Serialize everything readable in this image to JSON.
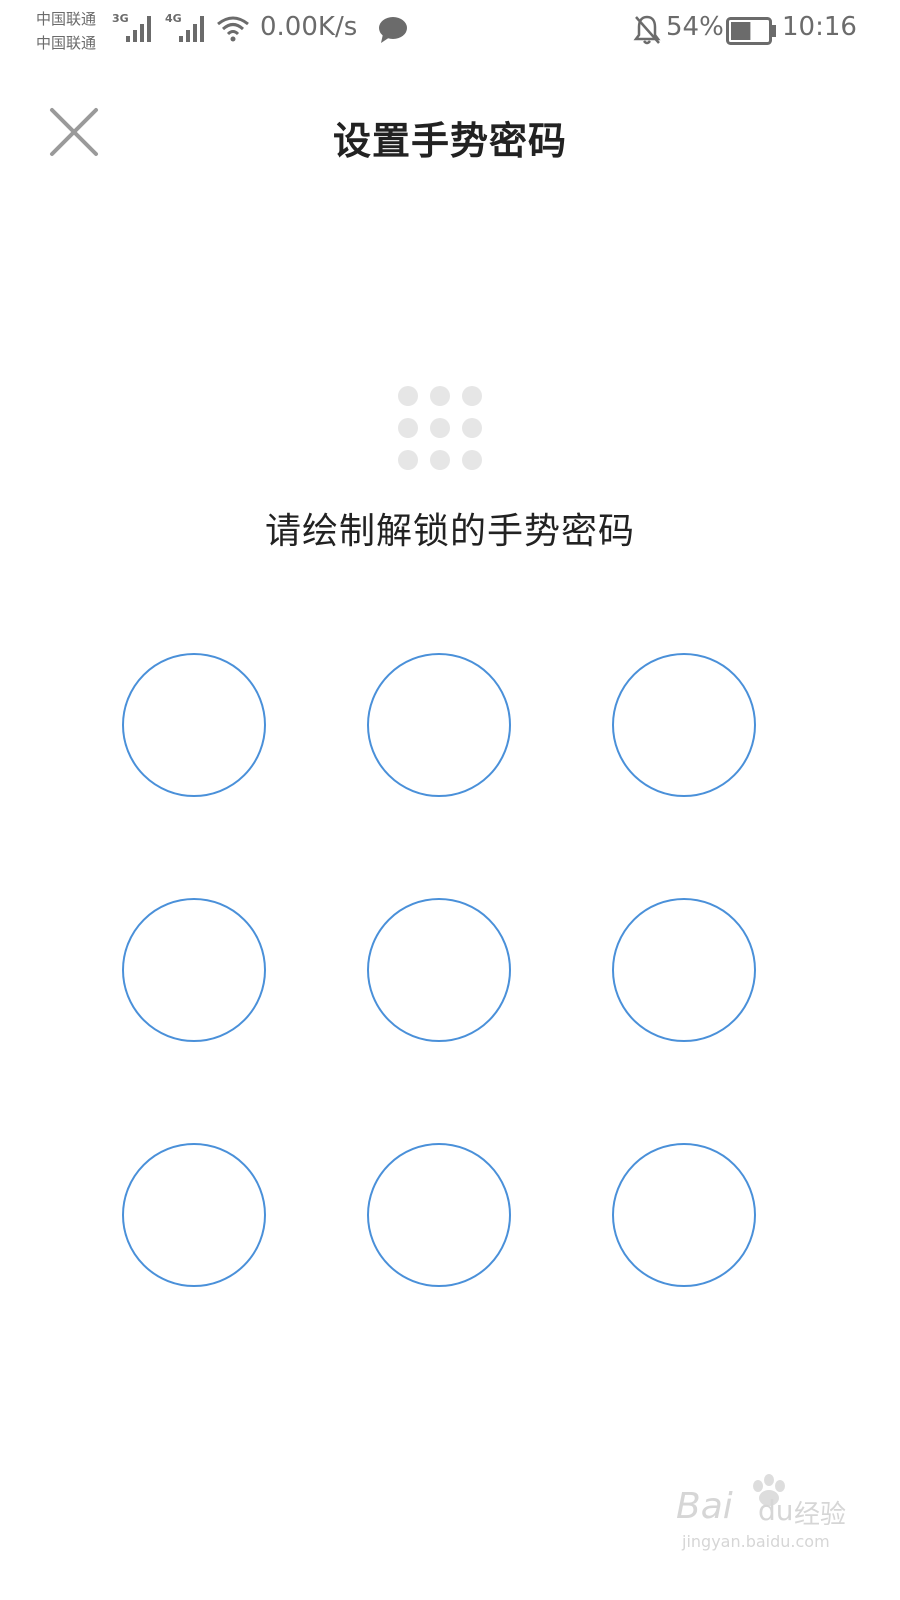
{
  "status_bar": {
    "carrier_1": "中国联通",
    "carrier_2": "中国联通",
    "network_1": "3G",
    "network_2": "4G",
    "net_speed": "0.00K/s",
    "battery_percent": "54%",
    "battery_level": 0.54,
    "time": "10:16",
    "icons": [
      "signal-icon",
      "wifi-icon",
      "chat-icon",
      "bell-off-icon",
      "battery-icon"
    ]
  },
  "header": {
    "title": "设置手势密码",
    "close_icon": "close-icon"
  },
  "instruction": "请绘制解锁的手势密码",
  "pattern": {
    "nodes": [
      1,
      2,
      3,
      4,
      5,
      6,
      7,
      8,
      9
    ],
    "color": "#4a90d9"
  },
  "watermark": {
    "brand": "Bai",
    "brand_suffix": "du",
    "product": "经验",
    "url": "jingyan.baidu.com"
  }
}
